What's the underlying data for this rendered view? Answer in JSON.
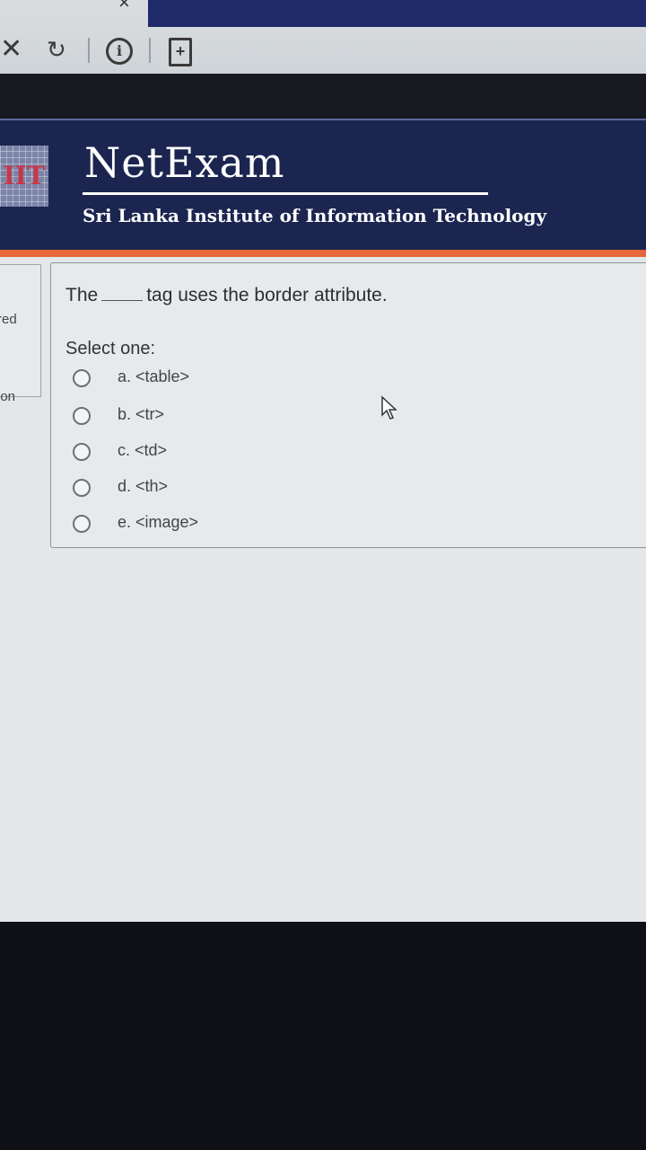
{
  "browser": {
    "close_glyph": "×",
    "stop_glyph": "✕",
    "reload_glyph": "↻",
    "info_glyph": "i",
    "page_glyph": "+"
  },
  "header": {
    "logo_text": "IIT",
    "brand": "NetExam",
    "institute": "Sri Lanka Institute of Information Technology"
  },
  "sidebar": {
    "fragment_1": "red",
    "fragment_2": "ion"
  },
  "question": {
    "prefix": "The",
    "suffix": "tag uses the border attribute.",
    "prompt": "Select one:",
    "options": [
      {
        "label": "a. <table>"
      },
      {
        "label": "b. <tr>"
      },
      {
        "label": "c. <td>"
      },
      {
        "label": "d. <th>"
      },
      {
        "label": "e. <image>"
      }
    ]
  },
  "colors": {
    "header_bg": "#1b2550",
    "accent_orange": "#e5673a"
  },
  "icons": [
    "close-icon",
    "reload-icon",
    "info-icon",
    "page-icon",
    "mouse-pointer-icon"
  ]
}
